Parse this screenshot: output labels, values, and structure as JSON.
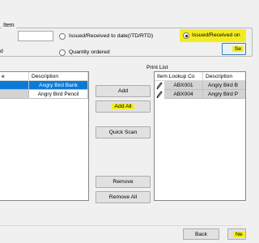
{
  "filter": {
    "group_title": "Item",
    "left_label": "d",
    "text_value": "",
    "radio_itd": "Issued/Received to date(ITD/RTD)",
    "radio_issued_on": "Issued/Received on",
    "radio_qty": "Quantity ordered",
    "selected_radio": "issued_on",
    "search_button": "Se"
  },
  "left_grid": {
    "columns": [
      "e",
      "Description"
    ],
    "rows": [
      {
        "code": "",
        "description": "Angry Bird Bank",
        "selected": true
      },
      {
        "code": "",
        "description": "Angry Bird Pencil",
        "selected": false
      }
    ]
  },
  "buttons": {
    "add": "Add",
    "add_all": "Add All",
    "quick_scan": "Quick Scan",
    "remove": "Remove",
    "remove_all": "Remove All"
  },
  "print_list": {
    "title": "Print List",
    "columns": [
      "Item Lookup Co",
      "Description"
    ],
    "rows": [
      {
        "code": "ABX001",
        "description": "Angry Bird B"
      },
      {
        "code": "ABX004",
        "description": "Angry Bird P"
      }
    ]
  },
  "footer": {
    "back": "Back",
    "next": "Ne"
  },
  "colors": {
    "highlight": "#f3ec22",
    "selection": "#0a7ad6"
  },
  "icons": {
    "row_edit": "pencil-icon"
  }
}
